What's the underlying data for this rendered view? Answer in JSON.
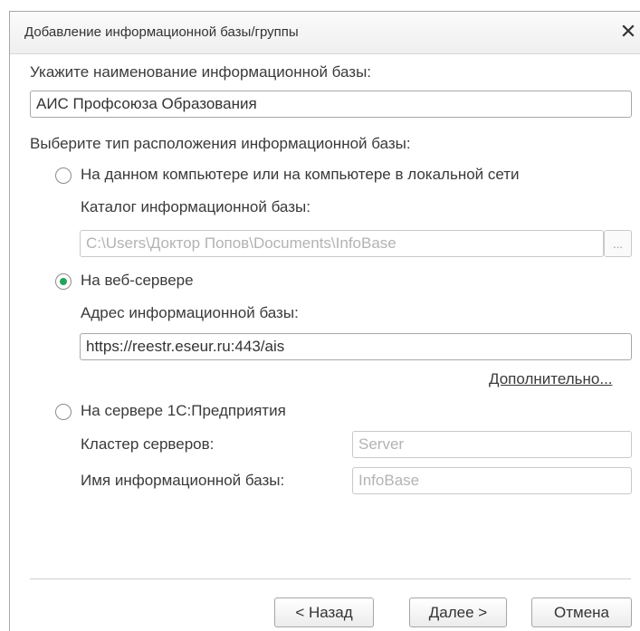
{
  "window": {
    "title": "Добавление информационной базы/группы"
  },
  "name_section": {
    "label": "Укажите наименование информационной базы:",
    "value": "АИС Профсоюза Образования"
  },
  "location_section": {
    "label": "Выберите тип расположения информационной базы:",
    "options": [
      {
        "label": "На данном компьютере или на компьютере в локальной сети",
        "selected": false,
        "field_label": "Каталог информационной базы:",
        "field_value": "C:\\Users\\Доктор Попов\\Documents\\InfoBase",
        "browse_label": "..."
      },
      {
        "label": "На веб-сервере",
        "selected": true,
        "field_label": "Адрес информационной базы:",
        "field_value": "https://reestr.eseur.ru:443/ais",
        "advanced_link": "Дополнительно..."
      },
      {
        "label": "На сервере 1С:Предприятия",
        "selected": false,
        "cluster_label": "Кластер серверов:",
        "cluster_value": "Server",
        "db_label": "Имя информационной базы:",
        "db_value": "InfoBase"
      }
    ]
  },
  "buttons": {
    "back": "< Назад",
    "next": "Далее >",
    "cancel": "Отмена"
  },
  "colors": {
    "radio_selected": "#26a35d"
  },
  "icons": {
    "close": "close-icon"
  }
}
